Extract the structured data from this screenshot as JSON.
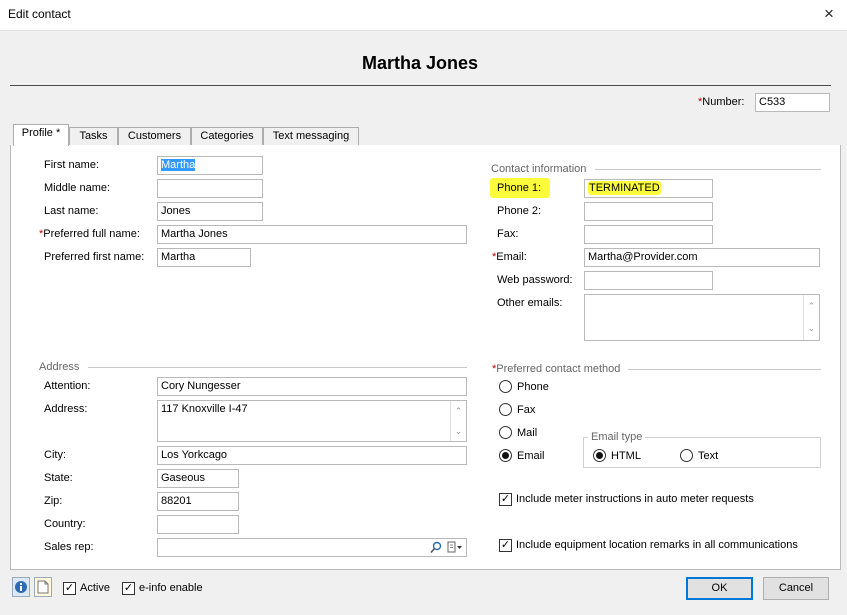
{
  "window": {
    "title": "Edit contact",
    "close_icon": "×"
  },
  "header": {
    "contact_name": "Martha Jones",
    "number_label": "Number:",
    "number_value": "C533"
  },
  "tabs": [
    {
      "label": "Profile *",
      "active": true
    },
    {
      "label": "Tasks",
      "active": false
    },
    {
      "label": "Customers",
      "active": false
    },
    {
      "label": "Categories",
      "active": false
    },
    {
      "label": "Text messaging",
      "active": false
    }
  ],
  "profile": {
    "first_name_label": "First name:",
    "first_name": "Martha",
    "middle_name_label": "Middle name:",
    "middle_name": "",
    "last_name_label": "Last name:",
    "last_name": "Jones",
    "preferred_full_name_label": "Preferred full name:",
    "preferred_full_name": "Martha Jones",
    "preferred_first_name_label": "Preferred first name:",
    "preferred_first_name": "Martha"
  },
  "contact_info": {
    "group_title": "Contact information",
    "phone1_label": "Phone 1:",
    "phone1": "TERMINATED",
    "phone2_label": "Phone 2:",
    "phone2": "",
    "fax_label": "Fax:",
    "fax": "",
    "email_label": "Email:",
    "email": "Martha@Provider.com",
    "web_password_label": "Web password:",
    "web_password": "",
    "other_emails_label": "Other emails:",
    "other_emails": "",
    "highlight_color": "#fbfb3c"
  },
  "address": {
    "group_title": "Address",
    "attention_label": "Attention:",
    "attention": "Cory Nungesser",
    "address_label": "Address:",
    "address": "117 Knoxville I-47",
    "city_label": "City:",
    "city": "Los Yorkcago",
    "state_label": "State:",
    "state": "Gaseous",
    "zip_label": "Zip:",
    "zip": "88201",
    "country_label": "Country:",
    "country": "",
    "sales_rep_label": "Sales rep:",
    "sales_rep": "",
    "sales_rep_icons": [
      "search-icon",
      "lookup-dropdown-icon"
    ]
  },
  "preferred_contact": {
    "group_title": "Preferred contact method",
    "options": [
      "Phone",
      "Fax",
      "Mail",
      "Email"
    ],
    "selected": "Email",
    "email_type_title": "Email type",
    "email_type_options": [
      "HTML",
      "Text"
    ],
    "email_type_selected": "HTML"
  },
  "options": {
    "meter_instructions_label": "Include meter instructions in auto meter requests",
    "meter_instructions_checked": true,
    "equipment_remarks_label": "Include equipment location remarks in all communications",
    "equipment_remarks_checked": true
  },
  "footer": {
    "icons": [
      "info-icon",
      "notes-icon"
    ],
    "active_label": "Active",
    "active_checked": true,
    "einfo_label": "e-info enable",
    "einfo_checked": true,
    "ok_label": "OK",
    "cancel_label": "Cancel"
  },
  "colors": {
    "required_asterisk": "#c00000",
    "default_button_border": "#0078d7",
    "selection": "#3399ff"
  }
}
